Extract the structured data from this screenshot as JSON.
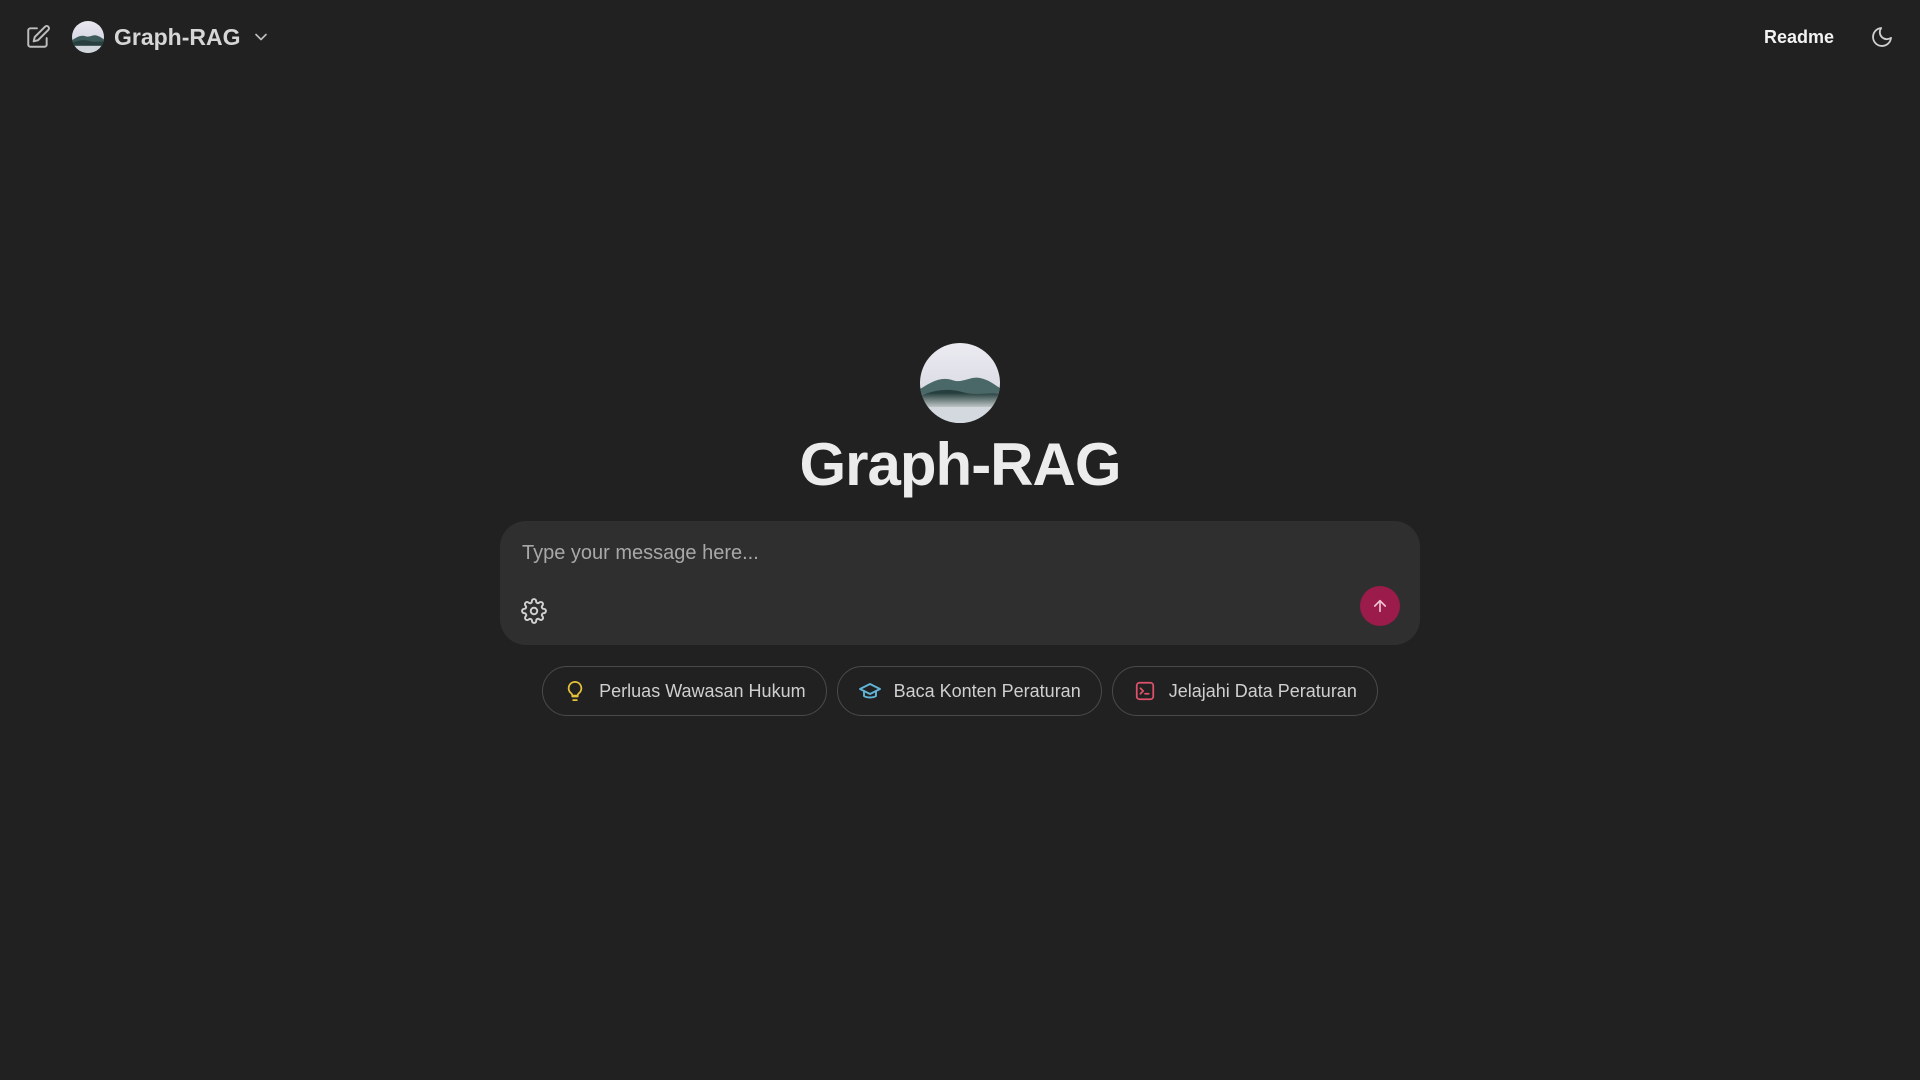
{
  "app": {
    "model_name": "Graph-RAG",
    "hero_title": "Graph-RAG"
  },
  "header": {
    "readme_label": "Readme"
  },
  "composer": {
    "placeholder": "Type your message here..."
  },
  "suggestions": [
    {
      "label": "Perluas Wawasan Hukum",
      "icon": "lightbulb-icon",
      "color": "#e6c13a"
    },
    {
      "label": "Baca Konten Peraturan",
      "icon": "graduation-cap-icon",
      "color": "#5fb4d8"
    },
    {
      "label": "Jelajahi Data Peraturan",
      "icon": "terminal-icon",
      "color": "#e0526b"
    }
  ],
  "colors": {
    "background": "#212121",
    "composer": "#2f2f2f",
    "send_button": "#9b1b4a"
  }
}
